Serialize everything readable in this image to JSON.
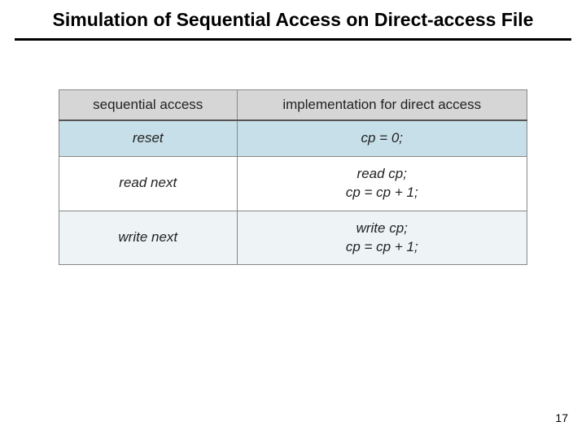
{
  "title": "Simulation of Sequential Access on Direct-access File",
  "table": {
    "headers": {
      "left": "sequential access",
      "right": "implementation for direct access"
    },
    "rows": {
      "reset": {
        "seq": "reset",
        "impl": "cp = 0;"
      },
      "read": {
        "seq": "read next",
        "impl": "read cp;\ncp = cp + 1;"
      },
      "write": {
        "seq": "write next",
        "impl": "write cp;\ncp = cp + 1;"
      }
    }
  },
  "page_number": "17"
}
